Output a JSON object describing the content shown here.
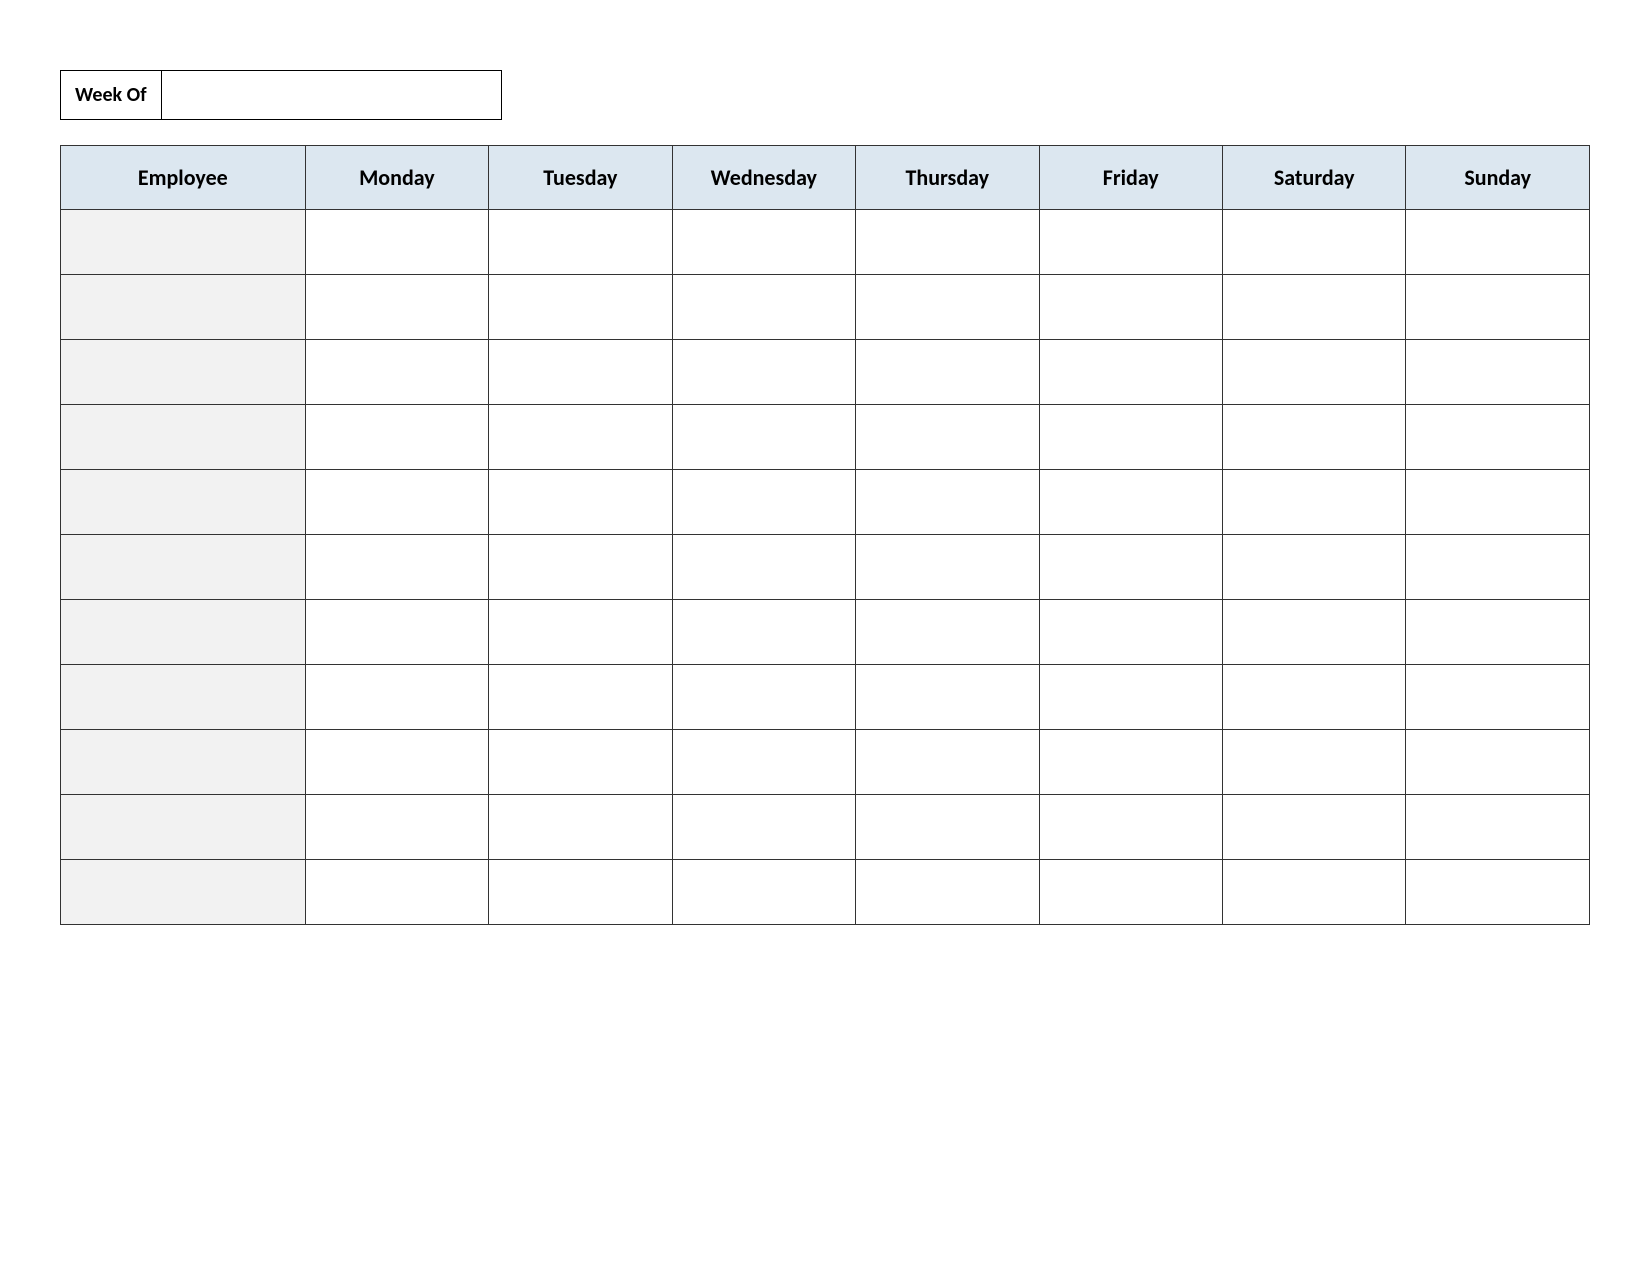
{
  "weekOf": {
    "label": "Week Of",
    "value": ""
  },
  "headers": {
    "employee": "Employee",
    "days": [
      "Monday",
      "Tuesday",
      "Wednesday",
      "Thursday",
      "Friday",
      "Saturday",
      "Sunday"
    ]
  },
  "rows": [
    {
      "employee": "",
      "cells": [
        "",
        "",
        "",
        "",
        "",
        "",
        ""
      ]
    },
    {
      "employee": "",
      "cells": [
        "",
        "",
        "",
        "",
        "",
        "",
        ""
      ]
    },
    {
      "employee": "",
      "cells": [
        "",
        "",
        "",
        "",
        "",
        "",
        ""
      ]
    },
    {
      "employee": "",
      "cells": [
        "",
        "",
        "",
        "",
        "",
        "",
        ""
      ]
    },
    {
      "employee": "",
      "cells": [
        "",
        "",
        "",
        "",
        "",
        "",
        ""
      ]
    },
    {
      "employee": "",
      "cells": [
        "",
        "",
        "",
        "",
        "",
        "",
        ""
      ]
    },
    {
      "employee": "",
      "cells": [
        "",
        "",
        "",
        "",
        "",
        "",
        ""
      ]
    },
    {
      "employee": "",
      "cells": [
        "",
        "",
        "",
        "",
        "",
        "",
        ""
      ]
    },
    {
      "employee": "",
      "cells": [
        "",
        "",
        "",
        "",
        "",
        "",
        ""
      ]
    },
    {
      "employee": "",
      "cells": [
        "",
        "",
        "",
        "",
        "",
        "",
        ""
      ]
    },
    {
      "employee": "",
      "cells": [
        "",
        "",
        "",
        "",
        "",
        "",
        ""
      ]
    }
  ]
}
